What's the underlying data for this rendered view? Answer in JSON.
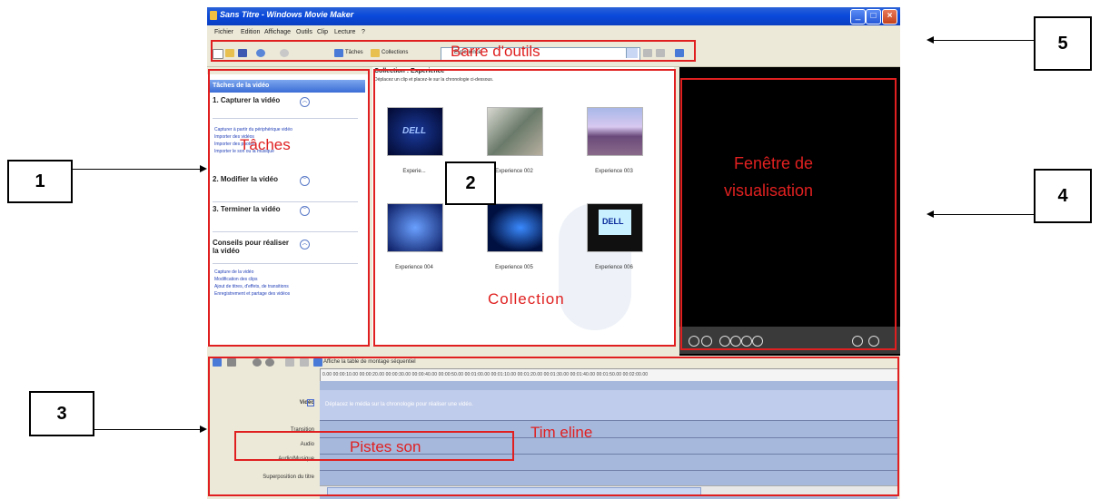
{
  "window": {
    "title": "Sans Titre - Windows Movie Maker"
  },
  "menu": [
    "Fichier",
    "Edition",
    "Affichage",
    "Outils",
    "Clip",
    "Lecture",
    "?"
  ],
  "toolbar": {
    "tasks_label": "Tâches",
    "collections_label": "Collections",
    "combo_value": "Experience"
  },
  "tasks_pane": {
    "header": "Tâches de la vidéo",
    "sections": [
      {
        "title": "1. Capturer la vidéo",
        "links": [
          "Capturer à partir du périphérique vidéo",
          "Importer des vidéos",
          "Importer des photos",
          "Importer le son ou la musique"
        ]
      },
      {
        "title": "2. Modifier la vidéo",
        "links": []
      },
      {
        "title": "3. Terminer la vidéo",
        "links": []
      },
      {
        "title": "Conseils pour réaliser la vidéo",
        "links": [
          "Capture de la vidéo",
          "Modification des clips",
          "Ajout de titres, d'effets, de transitions",
          "Enregistrement et partage des vidéos"
        ]
      }
    ]
  },
  "collection": {
    "title": "Collection : Experience",
    "subtitle": "Déplacez un clip et placez-le sur la chronologie ci-dessous.",
    "items": [
      "Experie...",
      "Experience 002",
      "Experience 003",
      "Experience 004",
      "Experience 005",
      "Experience 006"
    ]
  },
  "timeline": {
    "storyboard_label": "Affiche la table de montage séquentiel",
    "ruler": "0.00  00:00:10.00  00:00:20.00  00:00:30.00  00:00:40.00  00:00:50.00  00:01:00.00  00:01:10.00  00:01:20.00  00:01:30.00  00:01:40.00  00:01:50.00  00:02:00.00",
    "hint": "Déplacez le média sur la chronologie pour réaliser une vidéo.",
    "tracks": [
      "Vidéo",
      "Transition",
      "Audio",
      "Audio/Musique",
      "Superposition du titre"
    ]
  },
  "annotations": {
    "toolbar": "Barre d'outils",
    "tasks": "Tâches",
    "preview_l1": "Fenêtre de",
    "preview_l2": "visualisation",
    "collection": "Collection",
    "timeline": "Tim eline",
    "audio": "Pistes son"
  },
  "callouts": [
    "1",
    "2",
    "3",
    "4",
    "5"
  ],
  "colors": {
    "annotation_red": "#e02020",
    "titlebar_blue": "#0a4adb",
    "preview_bg": "#000000"
  }
}
